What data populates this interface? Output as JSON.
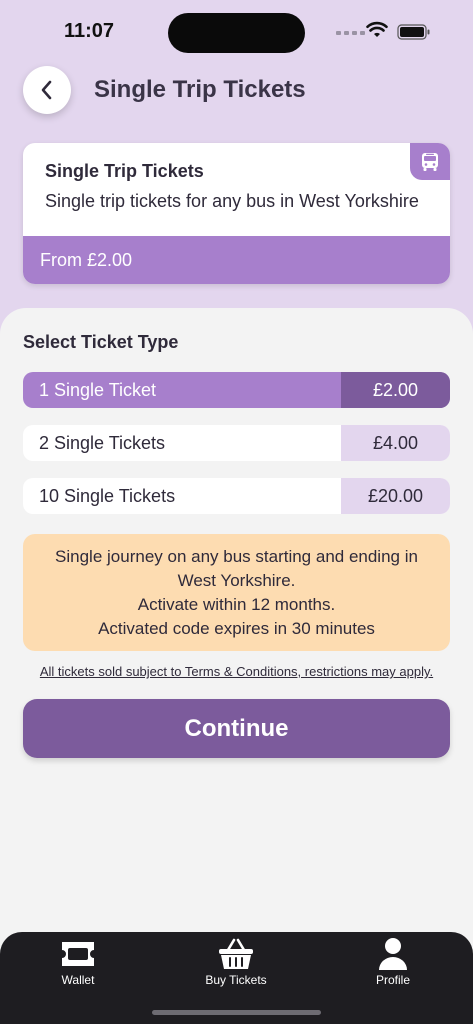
{
  "status_bar": {
    "time": "11:07"
  },
  "header": {
    "title": "Single Trip Tickets",
    "back_icon": "chevron-left-icon"
  },
  "product": {
    "title": "Single Trip Tickets",
    "description": "Single trip tickets for any bus in West Yorkshire",
    "price_from": "From £2.00",
    "badge_icon": "bus-icon"
  },
  "ticket_section": {
    "title": "Select Ticket Type",
    "options": [
      {
        "label": "1 Single Ticket",
        "price": "£2.00",
        "selected": true
      },
      {
        "label": "2 Single Tickets",
        "price": "£4.00",
        "selected": false
      },
      {
        "label": "10 Single Tickets",
        "price": "£20.00",
        "selected": false
      }
    ]
  },
  "info": {
    "lines": [
      "Single journey on any bus starting and ending in",
      "West Yorkshire.",
      "Activate within 12 months.",
      "Activated code expires in 30 minutes"
    ]
  },
  "terms": "All tickets sold subject to Terms & Conditions, restrictions may apply.",
  "continue_label": "Continue",
  "tab_bar": {
    "tabs": [
      {
        "label": "Wallet",
        "icon": "ticket-icon"
      },
      {
        "label": "Buy Tickets",
        "icon": "basket-icon"
      },
      {
        "label": "Profile",
        "icon": "person-icon"
      }
    ]
  },
  "colors": {
    "accent": "#a77fcc",
    "accent_dark": "#7c5b9c",
    "header_bg": "#e3d6ee",
    "info_bg": "#fddcb1",
    "tab_bar_bg": "#1e1d21"
  }
}
